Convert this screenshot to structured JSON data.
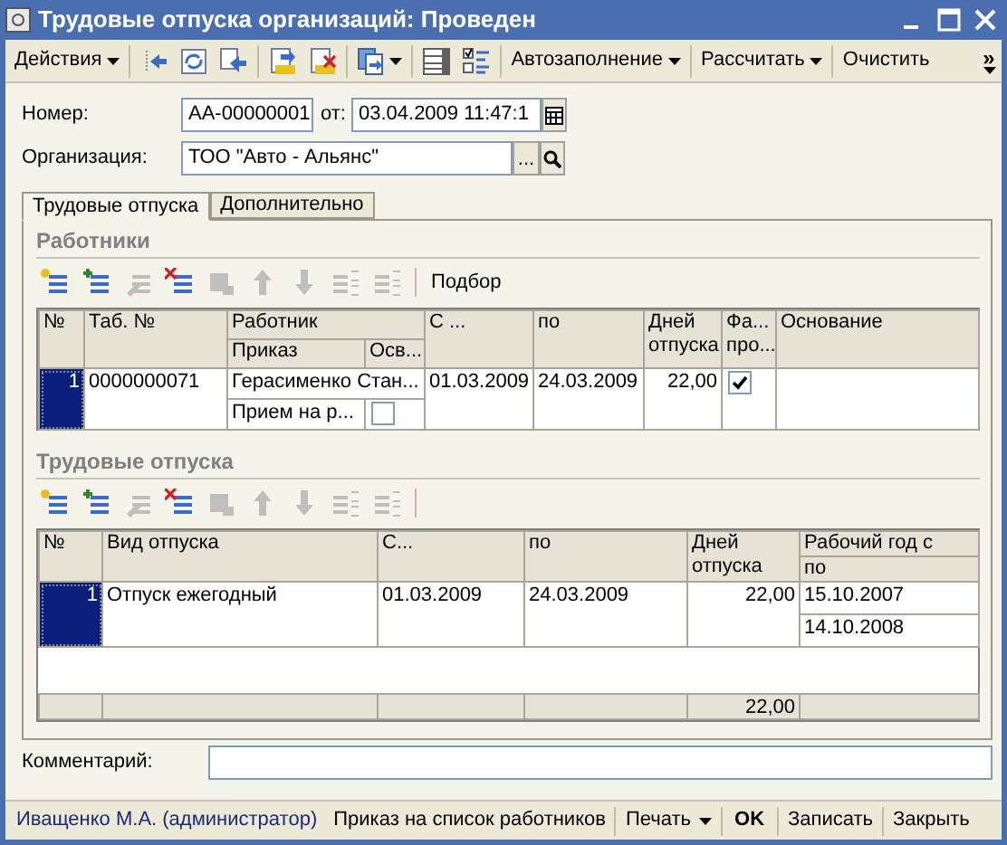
{
  "window": {
    "title": "Трудовые отпуска организаций: Проведен"
  },
  "toolbar": [
    {
      "kind": "menu",
      "label": "Действия"
    },
    {
      "kind": "icon"
    },
    {
      "kind": "icon"
    },
    {
      "kind": "icon"
    },
    {
      "kind": "icon"
    },
    {
      "kind": "icon"
    },
    {
      "kind": "icon_menu"
    },
    {
      "kind": "icon"
    },
    {
      "kind": "icon"
    },
    {
      "kind": "menu",
      "label": "Автозаполнение"
    },
    {
      "kind": "menu",
      "label": "Рассчитать"
    },
    {
      "kind": "button",
      "label": "Очистить"
    },
    {
      "kind": "overflow",
      "label": "»"
    }
  ],
  "fields": {
    "number": {
      "label": "Номер:",
      "value": "АА-00000001"
    },
    "date": {
      "label": "от:",
      "value": "03.04.2009 11:47:1"
    },
    "organization": {
      "label": "Организация:",
      "value": "ТОО \"Авто - Альянс\"",
      "button": "..."
    }
  },
  "tabs": [
    {
      "label": "Трудовые отпуска",
      "selected": true
    },
    {
      "label": "Дополнительно",
      "selected": false
    }
  ],
  "workers": {
    "title": "Работники",
    "toolbar": [
      {
        "kind": "icon",
        "disabled": false
      },
      {
        "kind": "icon",
        "disabled": false
      },
      {
        "kind": "icon",
        "disabled": true
      },
      {
        "kind": "icon",
        "disabled": false
      },
      {
        "kind": "icon",
        "disabled": true
      },
      {
        "kind": "icon",
        "disabled": true
      },
      {
        "kind": "icon",
        "disabled": true
      },
      {
        "kind": "icon",
        "disabled": true
      },
      {
        "kind": "icon",
        "disabled": true
      },
      {
        "kind": "button",
        "label": "Подбор"
      }
    ],
    "headers": {
      "number": "№",
      "tab_number": "Таб. №",
      "employee": "Работник",
      "order": "Приказ",
      "released": "Осв...",
      "from": "С ...",
      "to": "по",
      "days": "Дней отпуска",
      "actual": "Фа... про...",
      "basis": "Основание"
    },
    "rows": [
      {
        "number": "1",
        "selected": true,
        "tab_number": "0000000071",
        "employee": "Герасименко Стан...",
        "order": "Прием на р...",
        "released": false,
        "from": "01.03.2009",
        "to": "24.03.2009",
        "days": "22,00",
        "actual": true
      }
    ]
  },
  "vacations": {
    "title": "Трудовые отпуска",
    "toolbar": [
      {
        "kind": "icon",
        "disabled": false
      },
      {
        "kind": "icon",
        "disabled": false
      },
      {
        "kind": "icon",
        "disabled": true
      },
      {
        "kind": "icon",
        "disabled": false
      },
      {
        "kind": "icon",
        "disabled": true
      },
      {
        "kind": "icon",
        "disabled": true
      },
      {
        "kind": "icon",
        "disabled": true
      },
      {
        "kind": "icon",
        "disabled": true
      },
      {
        "kind": "icon",
        "disabled": true
      }
    ],
    "headers": {
      "number": "№",
      "type": "Вид отпуска",
      "from": "С...",
      "to": "по",
      "days": "Дней отпуска",
      "year_from": "Рабочий год с",
      "year_to": "по"
    },
    "rows": [
      {
        "number": "1",
        "selected": true,
        "type": "Отпуск ежегодный",
        "from": "01.03.2009",
        "to": "24.03.2009",
        "days": "22,00",
        "year_from": "15.10.2007",
        "year_to": "14.10.2008"
      }
    ],
    "totals": {
      "days": "22,00"
    }
  },
  "comment": {
    "label": "Комментарий:"
  },
  "footer": {
    "user": "Иващенко М.А. (администратор)",
    "buttons": [
      {
        "kind": "button",
        "label": "Приказ на список работников"
      },
      {
        "kind": "menu",
        "label": "Печать"
      },
      {
        "kind": "default",
        "label": "OK"
      },
      {
        "kind": "button",
        "label": "Записать"
      },
      {
        "kind": "button",
        "label": "Закрыть"
      }
    ]
  }
}
